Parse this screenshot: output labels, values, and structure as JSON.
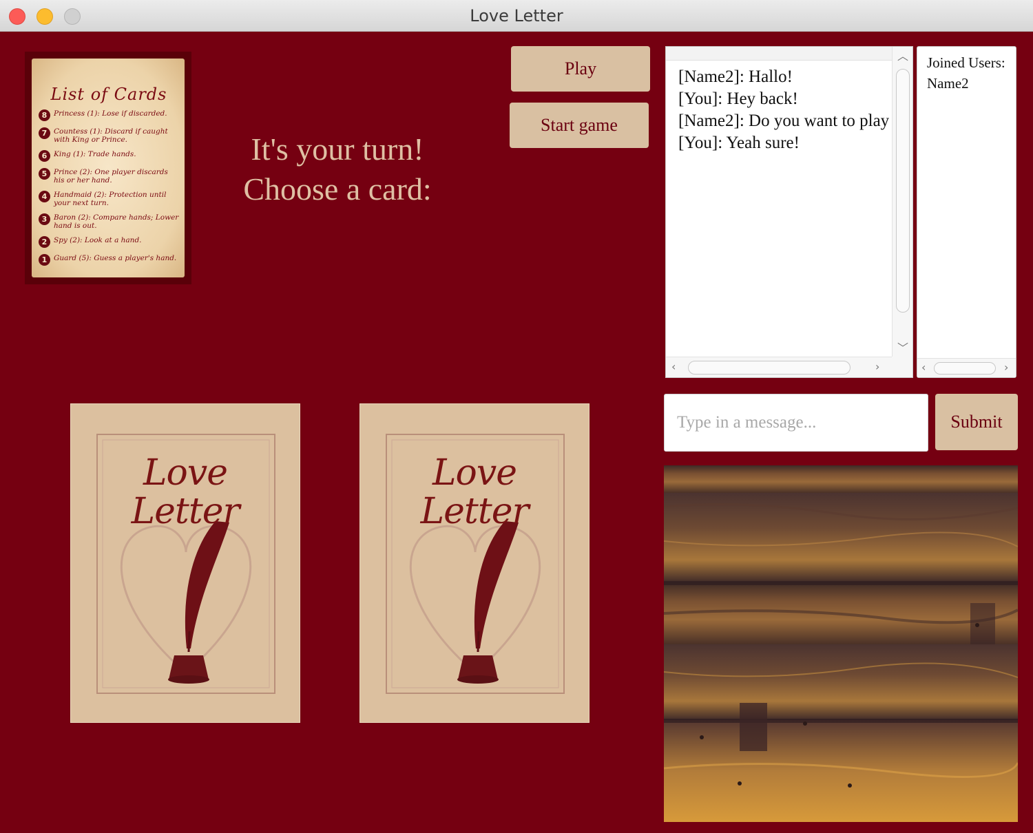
{
  "window": {
    "title": "Love Letter"
  },
  "card_list": {
    "title": "List of Cards",
    "items": [
      {
        "num": "8",
        "text": "Princess (1): Lose if discarded."
      },
      {
        "num": "7",
        "text": "Countess (1): Discard if caught with King or Prince."
      },
      {
        "num": "6",
        "text": "King (1): Trade hands."
      },
      {
        "num": "5",
        "text": "Prince (2): One player discards his or her hand."
      },
      {
        "num": "4",
        "text": "Handmaid (2): Protection until your next turn."
      },
      {
        "num": "3",
        "text": "Baron (2): Compare hands; Lower hand is out."
      },
      {
        "num": "2",
        "text": "Spy (2): Look at a hand."
      },
      {
        "num": "1",
        "text": "Guard (5): Guess a player's hand."
      }
    ]
  },
  "status": {
    "line1": "It's your turn!",
    "line2": "Choose a card:"
  },
  "buttons": {
    "play": "Play",
    "start_game": "Start game",
    "submit": "Submit"
  },
  "chat": {
    "messages": [
      "[Name2]: Hallo!",
      "[You]: Hey back!",
      "[Name2]: Do you want to play",
      "[You]: Yeah sure!"
    ],
    "input_placeholder": "Type in a message..."
  },
  "users": {
    "header": "Joined Users:",
    "list": [
      "Name2"
    ]
  },
  "hand": {
    "card_back_logo_line1": "Love",
    "card_back_logo_line2": "Letter"
  },
  "colors": {
    "background": "#750011",
    "button": "#d9c0a2",
    "button_text": "#6a0010",
    "status_text": "#dfc0a4",
    "card": "#dcc09f"
  }
}
